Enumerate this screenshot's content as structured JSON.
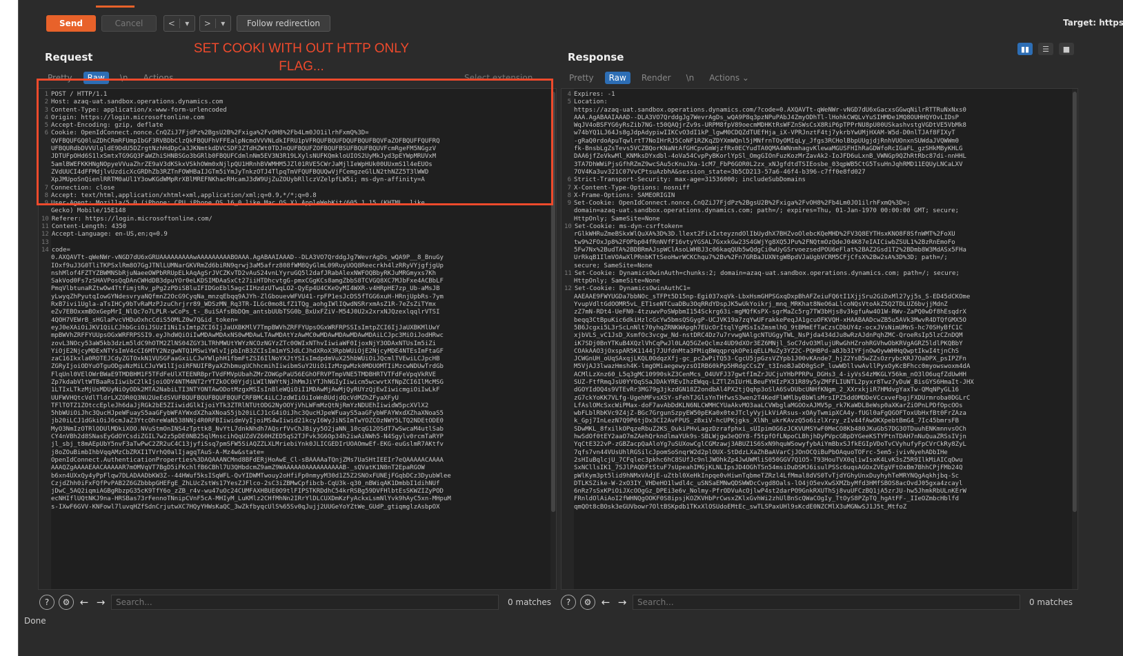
{
  "toolbar": {
    "send": "Send",
    "cancel": "Cancel",
    "back": "<",
    "forward": ">",
    "dropdown_arrow": "▾",
    "follow": "Follow redirection",
    "target": "Target: https"
  },
  "annotation": {
    "line1": "SET COOKI WITH OUT HTTP ONLY",
    "line2": "FLAG..."
  },
  "request": {
    "title": "Request",
    "tabs": [
      "Pretty",
      "Raw",
      "\\n",
      "Actions ⌄"
    ],
    "active_tab": "Raw",
    "select_extension": "Select extension...",
    "lines": [
      {
        "n": "1",
        "t": "POST / HTTP/1.1"
      },
      {
        "n": "2",
        "t": "Host: azaq-uat.sandbox.operations.dynamics.com"
      },
      {
        "n": "3",
        "t": "Content-Type: application/x-www-form-urlencoded"
      },
      {
        "n": "4",
        "t": "Origin: https://login.microsoftonline.com"
      },
      {
        "n": "5",
        "t": "Accept-Encoding: gzip, deflate"
      },
      {
        "n": "6",
        "t": "Cookie: OpenIdConnect.nonce.CnQZiJ7FjdPz%2BgsU2B%2Fxiga%2FvOH8%2Fb4Lm0JO1ilrhFxmQ%3D="
      },
      {
        "n": "",
        "t": "QVFBQUFGQ0luZDhCRmRFUmpIbGF3RVBDbClzQkFBQUFhVFFEalpNcmdVVVNLdkIFRU1pVFRQUFBQUFDQUFBQUFBQVFaZOFBQUFFQUFRQ"
      },
      {
        "n": "",
        "t": "UFBQURdbDVVUlgldE9DdU5DZrgtNzhHdDpCa3JKNmtkdDVCSDF3ZTdHZWt0TDJnQUFBQUFZOFBQUFBSUFBQUFBQUVFcmRgeFM5NGgzV"
      },
      {
        "n": "",
        "t": "JDTUFpOHd6S1lxSmtxTG9GQ3FaWZhiSHNBSGo3bGRlb0FBQUFCdmlnNm5EV3N3R19LXylsNUFKQmkloUIOS2UyMkJyd3pEYWpMRUVxM"
      },
      {
        "n": "",
        "t": "5amlBWEFKKHNgNOpyeVVuaZhrZE9aV3dKSkxVSkhOWm0xNjlpQU1HRnhBVWMHM5JZl01RVE5CWrJaMjlIeWpHUk00UUxmS1l4eEUOs"
      },
      {
        "n": "",
        "t": "ZVdUUCI4dFFMdjlvUzdicXcGRDhZb3RZTnFOWHBaIJGTm5iYmJyTnkzOTJ4TlpqTmVFQUFBQUQwVjFCemgzeGlLN2thNZZ5T3lWWD"
      },
      {
        "n": "",
        "t": "XpJMUpoSnQienlRRTM0aUl1Y3owKGdWMpRrXBlMREFNKhacRHcamJ3dW9UjZuZOUybRllczVZelpfLW5i; ms-dyn-affinity=A"
      },
      {
        "n": "7",
        "t": "Connection: close"
      },
      {
        "n": "8",
        "t": "Accept: text/html,application/xhtml+xml,application/xml;q=0.9,*/*;q=0.8"
      },
      {
        "n": "9",
        "t": "User-Agent: Mozilla/5.0 (iPhone; CPU iPhone OS 16_0 like Mac OS X) AppleWebKit/605.1.15 (KHTML, like"
      },
      {
        "n": "",
        "t": "Gecko) Mobile/15E148"
      },
      {
        "n": "10",
        "t": "Referer: https://login.microsoftonline.com/"
      },
      {
        "n": "11",
        "t": "Content-Length: 4350"
      },
      {
        "n": "12",
        "t": "Accept-Language: en-US,en;q=0.9"
      },
      {
        "n": "13",
        "t": ""
      },
      {
        "n": "14",
        "t": "code="
      },
      {
        "n": "",
        "t": "0.AXQAVTt-qWeNWr-vNGD7dU6xGRUAAAAAAAAAwAAAAAAAAABOAAA.AgABAAIAAAD--DLA3VO7QrddgJg7WevrAgDs_wQA9P__8_BnuGy"
      },
      {
        "n": "",
        "t": "IOxf9uJ3G0TliTKPSxlRm8O7GgJTNlLUMNarGKVRmZd6biRN9qrwj3aM5afrz808fWM8QyGlmL09RuyUOQ8Reecrkh4lzRRyVYjgfjgUp"
      },
      {
        "n": "",
        "t": "nshMlof4FZTYZBWMNSbRjuNaeeOWPbRRUpELkAqAgSrJVCZKvTD2vAuS24vnLYyruGQ5l2dafJRabAlexNWFOQBbyRKJuMRGmyxs7Kh"
      },
      {
        "n": "",
        "t": "SakVod0Fs7zSHAVPosQqDAnCWHdDB3dpuYOr0eLKDSIMDAaSxCt27iiHTDhcvtgG-pmxCGgKCs8amgZbbS8TCVGQ8XC7MJbFxe4ACBbLF"
      },
      {
        "n": "",
        "t": "PmqVlbtunaRZtwOw4TtfimjtRv_pPg2zPDiSBluIFIDGoEbl5agcIIHzdzUTwqLO2-QyEp4U4CKeOyMI4WXR-v4HRpHE7zp_Ub-aMsJB"
      },
      {
        "n": "",
        "t": "yLwyqZhPyutqIowGYNdesvryaNQfmnZ2OcG9CyqNa_mnzqEbqq9AJYh-ZlGbouevWFVU41-rpFP1esJcDS5fTGG6xuH-HRnjUpbRs-7ym"
      },
      {
        "n": "",
        "t": "RxB7ivi1Ugla-aTsIHCy9bTvRaMzPJzuChrjrr89_WDSzMN_Rq3TR-ILGc0mo8LfZ1TQg_aohgIWlIQwdNSRrxmAsZ1R-7eZsZiTYmx"
      },
      {
        "n": "",
        "t": "eZv7EBOxxmBOxGepMrI_NlQc7o7LPLR-wCoPs_t-_8uiSAfsBbDQm_antsbUUbTSG0b_BxUxFZiV-M54J0U2x2xrxNJQzexlqqlrVTSI"
      },
      {
        "n": "",
        "t": "4QOH7VEWrB_sHGlaPvcVHDuOxhcCdiS5OMLZ0w7Q&id_token="
      },
      {
        "n": "",
        "t": "eyJ0eXAiOiJKV1QiLCJhbGciOiJSUzI1NiIsImtpZCI6IjJaUXBKMlV7TmpBWVhZRFFYUpsOGxWRFRPSSIsImtpZCI6IjJaUXBKMlUwY"
      },
      {
        "n": "",
        "t": "mpBWVhZRFFYUUpsOGxWRFRPSSI9.eyJhdWQiOiIwMDAwMDAxNS0wMDAwLTAwMDAtYzAwMC0wMDAwMDAwMDAwMDAiLCJpc3MiOiJodHRwc"
      },
      {
        "n": "",
        "t": "zovL3NOcy53aW5kb3dzLm5ldC9hOTM2ZlNS04ZGY3LTRhMWUtYWYzNCOzNGYzZTc0OWIxNThvIiwiaWF0IjoxNjY3ODAxNTUsIm5iZi"
      },
      {
        "n": "",
        "t": "YiOjE2NjcyMDExNTYsImV4cCI6MTY2NzgwNTQ1MSwiYWlvIjpbInB3ZCIsIm1mYSJdLCJhdXRoX3RpbWUiOjE2NjcyMDE4NTEsImFtaGF"
      },
      {
        "n": "",
        "t": "zaC16Ikxla0ROTEJCdyZGTOxkN1VUSGFaaGxiLCJwYWlphH1fbmFtZSI6IlNoYXJtYSIsImdpdmVuX25hbWUiOiJQcmlTVEwiLCJpcHB"
      },
      {
        "n": "",
        "t": "ZGRyIjoiODYuOTguODguNzMiLCJuYW1lIjoiRFNUIFByaXZhbmugUChhcmihIiwibmSuY2UiOiIzMzgwMzk0MDUOMTIiMzcwNDUwTrdGb"
      },
      {
        "n": "",
        "t": "FlqUnl0VElOWrBWaE9TMDBHM1F5TFdFeUlXTEENRBprTVdFMVpUbahZMrZOWGpPaU56EGhOFRVPTmpVNE5TMDBHRTVTFdFeVpqVkRVE"
      },
      {
        "n": "",
        "t": "Zp7kdabVltWTBaaRsIiwibC2lkIjoiODY4NTM4NT2rYTZkOC00YjdjLWIlNWYtNjJhMmJiYTJhNGIyIiwicm5wcwvtXfNpZCI6IlMcMSG"
      },
      {
        "n": "",
        "t": "1LTIxLTkzMjUsMDUyNiOyODk2MTA2NabiLTI3NTYONTAwODotMzgxMSIsInBleWQiOiI1MDAwMjAwMjQyRUYzQjEwIiwicmgiOiIwLkF"
      },
      {
        "n": "",
        "t": "UUFWVHQtcVdlTldrLXZOR0Q3NU2UeEdSVUFBQUFBQUFBQUFBQUFCRFBMC4iLCJzdWIiOiIoWnBUdjdQcVdMZhZFyaXFyU"
      },
      {
        "n": "",
        "t": "TFlTOTZ1ZOtccEpleJh6daJjRGk2bE5ZIiwidGlkIjoiYTk3ZTRlNTUtODG2NyOOYjVhLWFmMzQtNjRmYzNDUEhIiwidW5pcXVlX2"
      },
      {
        "n": "",
        "t": "5hbWUiOiJhc3QucHJpeWFuayS5aaGFybWFAYWxdXZhaXNoaS5jb20iLCJ1cG4iOiJhc3QucHJpeWFuayS5aaGFybWFAYWxdXZhaXNoaS5"
      },
      {
        "n": "",
        "t": "jb20iLCJ1dGkiOiJ6cmJaZ3YtcOhreWaN538NNj4R0RFBIiwidmVyIjoiMS4wIiwid21kcyI6WyJiNSImTwYOZCOzNWY5LTQ2NDEtODE0"
      },
      {
        "n": "",
        "t": "MyO3NmIzOTRlODUlMDkiXOO.NVuStmOnINS4zTpttk8_NvYtL7dnkNhdh7AQsrfVvChJBiyy5O2jaNN_10cqG12OSdT7wSwcaM4utlSab"
      },
      {
        "n": "",
        "t": "CY4nVBh2d8SNasEyGdOYCsdiZGIL7w2z5pDE0NB25qlMnscihQqUZdVZ60HZED5qS2TJFvk3G6Op34h2iwAiNWh5-N4Sgylv0rcmTaRYP"
      },
      {
        "n": "",
        "t": "jl_sbj_t8mAEpUbY5nvF3aTwPwC2ZR2uC4C13jyfiSsq7pmSFW5SiAQZZLXLMriebiYnk0JLICGEDIrUOAOmwEf-EKG-euGslmR7AKtfv"
      },
      {
        "n": "",
        "t": "j8oZOuBimbIhbVqqAMzCbZRXI1TVrhQ0alIjagqTAuS-A-Mz4w&state="
      },
      {
        "n": "",
        "t": "OpenIdConnect.AuthenticationProperties%3DAQAAANCMnd8BFdERjHoAwE_Cl-sBAAAAaTQnjZMs7UaSHtIEEIr7eQAAAAACAAAA"
      },
      {
        "n": "",
        "t": "AAAQZgAAAAEAACAAAAAR7mOMVqVT7BgD5iFKchlfB6CBhl7U3QHbdcmZ9amZ9WAAAAA0AAAAAAAAAAB-_sQVatK1N8nT2EpaRGOW"
      },
      {
        "n": "",
        "t": "b6xn4UXxQy4yPpFlqw7DLADAADbKW3Z--44HWuf5ksISqWFL-QvYIDWMTwouy2oHfiFp0nmyyM30d1Z5Z2SNOxFUNEjFGqbDCz3DyubWlee"
      },
      {
        "n": "",
        "t": "CzjdZhh0iFxFQfPvPAB2Z6GZbbbpGHEFgE_ZhLUcZstWs17YesZJFlco-2sC3iZBMwCpfibcb-CqU3k-q30_nBWiqAK1DmbbI1dihNUf"
      },
      {
        "n": "",
        "t": "jDwC_5AQ2iqmiAGBgRbzpG35cK9TfY6o_zZB_r4v-wu47uOc24CUMFAXHBUE0O9tlFIPSTKRDdhC54krRSBg59DVFHlbtEsSKWZIZyPOD"
      },
      {
        "n": "",
        "t": "ecNHIflUQtNKJ9na-HRSBas73rFennoTNnipCVnF5cA-MHIyM_LuKMlz2CHfMhNn2IRrYlDLCUXDmKzFyAckxLsmNlYvk9hAyC5xn-MHpuM"
      },
      {
        "n": "",
        "t": "s-IXwF6GVV-KNFowl7luvqHZfSdnCrjutwXC7HQyYHWsKaQC_3wZkfbyqcUlS%65Sv0qJujj2UUGeYoYZtWe_GUdP_gtiqmglzAsbpOX"
      }
    ]
  },
  "response": {
    "title": "Response",
    "tabs": [
      "Pretty",
      "Raw",
      "Render",
      "\\n",
      "Actions ⌄"
    ],
    "active_tab": "Raw",
    "lines": [
      {
        "n": "4",
        "t": "Expires: -1"
      },
      {
        "n": "5",
        "t": "Location:"
      },
      {
        "n": "",
        "t": "https://azaq-uat.sandbox.operations.dynamics.com/?code=0.AXQAVTt-qWeNWr-vNGD7dU6xGacxsGGwqNilrRTTRuNxNxs0"
      },
      {
        "n": "",
        "t": "AAA.AgABAAIAAAD--DLA3VO7QrddgJg7WevrAgDs_wQA9P8q3pzNPuPAbJ4ZmyODhTl-lHohkCWQLvYuSIHMDe1MQ8OUHHQYOvLIDsP"
      },
      {
        "n": "",
        "t": "WqJV4oBSFYG6yRsZib7NG-t50QAQjrZv9s-URPM8fpV89oecmMDHKtRsWFZnSWsCsX8RiP6pTPPrNU8pU00USkashvstgVGDtVE5VbMk8"
      },
      {
        "n": "",
        "t": "w74bYQ1LJ64Js8gJdpAdypiwIIKCvO3dI1kP_lgwM0CDQZdTUEfHja_iX-VPRJnztF4tj7ykrbYwUMjHXAM-W5d-D0nlTJAf8FIXyT"
      },
      {
        "n": "",
        "t": "-gRaQ0rdoApuTqwlrtT7NoIHrRJ5CoNF1RZKqZDYXmWQnl5jMNfrnTOyOMIqLy_Jfgs3RCHolBbpUUgjdjRnhVUOnxnSUWdaJVQWWm0"
      },
      {
        "n": "",
        "t": "fk-BnsbLgZsTevs5VCZBQorKNaNtAfGHCpvGmWjzfRx0ECYudTA0QMA4WNnmhagvKlewaMGUSFHIhRaGDWfoRcIGaFL_gzSHkMByKHLG"
      },
      {
        "n": "",
        "t": "DAA6jfZeVkwMl_KNMksDYxdbl-4oVa54CvpPyBKorlYpSl_OmgGIOnFuzKozMrZavAk2-IoJFD6uLxnB_VWNGp9QZhRtRbc87di-nnHHL"
      },
      {
        "n": "",
        "t": "3TA7DhWWiPjsGfhRZmZ9wcSAu5cKnuJXa-1cM7_FbP6GOR0L2zx_xNJgfdtdTSIEosbe_03qpWB5CtG5TsuHnJqhRMD11EQUyLNCaLXV"
      },
      {
        "n": "",
        "t": "7OV4Ka3uv321C07VvCPtsuAzbhA&session_state=3b5CD213-57a6-46f4-b396-c7ff0e8fd027"
      },
      {
        "n": "6",
        "t": "Strict-Transport-Security: max-age=31536000; includeSubDomains"
      },
      {
        "n": "7",
        "t": "X-Content-Type-Options: nosniff"
      },
      {
        "n": "8",
        "t": "X-Frame-Options: SAMEORIGIN"
      },
      {
        "n": "9",
        "t": "Set-Cookie: OpenIdConnect.nonce.CnQZiJ7FjdPz%2BgsU2B%2Fxiga%2FvOH8%2Fb4Lm0JO1ilrhFxmQ%3D=;"
      },
      {
        "n": "",
        "t": "domain=azaq-uat.sandbox.operations.dynamics.com; path=/; expires=Thu, 01-Jan-1970 00:00:00 GMT; secure;"
      },
      {
        "n": "",
        "t": "HttpOnly; SameSite=None"
      },
      {
        "n": "10",
        "t": "Set-Cookie: ms-dyn-csrftoken="
      },
      {
        "n": "",
        "t": "rGlkWHRuZmeBSkxWlQuXA%3D%3D.llext2FixIxteyzndOlIbUydhX7BHZvoOlebcKQeMHD%2FV3Q8EYTHsxKNO8F8SfnWMT%2FoXU"
      },
      {
        "n": "",
        "t": "tw9%2FOxJp8%2FOPbp04fRnNVfF16vtyYGSAL7GxxkGw23S4GWjYg8XQ5JPu%2FNQtmOzQdeJ04K87eIAICiwbZSUL1%2BzRnEmoFo"
      },
      {
        "n": "",
        "t": "5Fw7Nx%2BudTA%2BDBRmAJspWClAsoLWHBJ3c06kaqQUb5wQdgCi0wUyGSrvoezsedPOU6eFlat%2BAZ2Gsd1T2%2BDmb8W3MdASx5FHa"
      },
      {
        "n": "",
        "t": "UrRkqB1IlmVOAwXlPRnbKTtSeoHwrWCKChqu7%2Bv%2Fn7GRBaJUXNtgWBpdVJaUgbVCRM5CFjCfsX%2Bw2sA%3D%3D; path=/;"
      },
      {
        "n": "",
        "t": "secure; SameSite=None"
      },
      {
        "n": "11",
        "t": "Set-Cookie: DynamicsOwinAuth=chunks:2; domain=azaq-uat.sandbox.operations.dynamics.com; path=/; secure;"
      },
      {
        "n": "",
        "t": "HttpOnly; SameSite=None"
      },
      {
        "n": "12",
        "t": "Set-Cookie: DynamicsOwinAuthC1="
      },
      {
        "n": "",
        "t": "AAEAAE9FWYUGDa7bbNOc_sTFPt5D15np-Egi037xqVk-LbxHsmGHPSGxqDxpBhAFZeiuFQ6tI1XjjSru2GiDxMl27yj5s_S-ED45dCKOme"
      },
      {
        "n": "",
        "t": "YvupVdltGdOOMR5vL_ET1seNTCuaDBu3OqRRdYDspJK5wUkYoikrj_mnq_MRKhat8NeO6aLlcoNQsVtoAkZ5Q2TDLUZ6bvjjMdnZ"
      },
      {
        "n": "",
        "t": "zZ7mN-RDt4-UeFN0-4tzuwvPoSWpbmI154Sckrg63i-mgMQfKsPX-sgrMaZc5rg7TW3bHjs8v3kgfuAw4O1W-RWv-ZaPQ0wDf8hEsqdrX"
      },
      {
        "n": "",
        "t": "beqq3CtBpuKic6dkiHzlcGcYw5bmsQSGygP-UCJVK19a7zqYwUFrakkePeqJA1gcuOFKVQH-xHAABAADcwZB5u5AVk3MwvR4DTQfGMX5O"
      },
      {
        "n": "",
        "t": "5B6Jcgxi5L3rScLnNlt70yhqZRNKWApgh7EUcOrItqlYgMSsIsZmsmlhQ_9tBMmEfTaCzsCDbUY4z-ocxJVsNimUMnS-hc70SHyBfC1C"
      },
      {
        "n": "",
        "t": "xjbVLS_vC1JsD_XsmfOc3vcgw_Nd-nstDRC4Dz7u7rvwgNAlgcNTUGgyTWL_NsPjda434dJu8wRzAJdnPqhZMC-QroeRsIp5lzCZnDQM"
      },
      {
        "n": "",
        "t": "iK7SDj0BnYTKuB4XQzlVhCqPwJl0LAQ5GZeQclmz4UD9dXOr3EZ6MNjl_SoC7dvO3MlujURwGhHZrohRGVhwObKRVgAGRZ5ldlPKQBbY"
      },
      {
        "n": "",
        "t": "COAkAAO3jOxspAR5K1144j7JUfdnMta3FMiqBWqqprqkOPeiqELLMuZy3YZ2C-PQHBPd-a8Jb3IYFjnOwOywWHHqQwptIkwI4tjnChS"
      },
      {
        "n": "",
        "t": "JCWGnUH_oUqSAxqjLKQL0OdqzXfj-gc_pcZwPiTQ53-CgcU5jpGzsVZYpb1J00vKAnde7_hjZ2YsB5wZZsOzrybcKRJ7OaDPX_psIPZFn"
      },
      {
        "n": "",
        "t": "M5VjAJ3lwazHmsh4K-lmgOMiaegewyzsOIRB60kPp5HRdgCCsZY_t3InoBJaDD0gScP_luwWDllvwAvllPyxOyKcBFhcc0myowswoxm4dA"
      },
      {
        "n": "",
        "t": "ACMlLzXnz60_L5q3gMC10990skZ3CenMcs_O4UVFJ37gwtfImZrJUCjuYHbPPRPu_DGHs3_4-iyVsS4zMKGLY56km_nO3lO6uqfZdUwHH"
      },
      {
        "n": "",
        "t": "SUZ-FtfRmqJsU0YYOqSSaJDAkYREvIhzEWqq-LZTlZnIUrHLBeuFYHIzPX31R89y5yZMFFLIUNTL2pyxr8Twz7yDuW_BisGYS6HmaIt-JHX"
      },
      {
        "n": "",
        "t": "dGOYIdOQ4s9VTEvRr3MG79g3jkzdGN18Z2ondbAl4PX2tjQqhp3oSlA6SvDUbcUNHfKNgm_2_XXrxkjiR7HMdvgYaxTw-QMqNPyGL16"
      },
      {
        "n": "",
        "t": "zG7ckYoKK7VLfg-UgehMFvsXSY-sFehTJGlsYnTHfwsS3wen2T4KedFlWMlbyBbWlsMrsIPZ5ddOMDDeVCcxveFbgjFXDUrmroba0DGLrC"
      },
      {
        "n": "",
        "t": "LfAslOMcSxcWiPMax-doF7avAbDdKLN6NLCWMHCYUaAkvMO3aaLCVWbglaMGOOxAJMV5p_rk7KaWDLBeWsp0aXKarZiOPnLPDfOpcOOs"
      },
      {
        "n": "",
        "t": "wbFLblRbKVc9Z4jZ-BGc7GrgunSzpyEW50pEKa0x0teJTclyVyjLkViARsus-xOAyTwmipXCA4y-fUGl0aFgQGOFToxUbHxfBt0FrZAza"
      },
      {
        "n": "",
        "t": "k_Gpj7InLezN7Q9P6tjDx3CI2AvFPUS_zBxiV-hcUPKjgks_XlNh_ukrKAvzQ5o6izlXrzy_zIv44fAwOKXpebtBmG4_7Ic45bmrsFB"
      },
      {
        "n": "",
        "t": "SDwMKL_8fxilkOPqzeRbuZ2KS_OukiPHvLagzDzrafphxi_sUIpimOG6zJCKVUMSYwF0MeCO8Kb480JKuGbS7DG3OTDuuhENKmnnvsOCh"
      },
      {
        "n": "",
        "t": "hwSdOf0tEY2aaO7mZAehQrkndlmaYUk9s-SBLWjgw3eQOY8-f5tpfOfLNpoCLBhjhDyPVpcGBpDYGeeKSTYPtnTDAH7nNuQuaZRSsIVjn"
      },
      {
        "n": "",
        "t": "YqCtE322vP-zGBZacpQaAloYg7uSUXowCglCGMzawj3ABUZ1S6SxN9hquWSowyfybAiYmBbxSJfkEGIpVDoTvCVyhufyFpCVrCkRy8ZyL"
      },
      {
        "n": "",
        "t": "7qfs7vn44VUsUhlRGSilcJpomSoSnqrW2d2plOUX-StDdzLXaZhBaAVarCjJOnOCQiBuPbOAquoTOFrc-5em5-jvivNyehADbIHe"
      },
      {
        "n": "",
        "t": "2sHIuBqlcjU_7CFqlec3pkhc6hC8SUfJc9nlJWOhkZp4JwUWMliS050GGV7Q1O5-T93HouTVX0qliwIsxK4LvK3sZ5R9IlkMiAICqOwu"
      },
      {
        "n": "",
        "t": "SxNCllsIK1_7SJlPAQDFtStuF7sUpeahIMGjKLNLIpsJD4OGhTSn54msiDuDSMJ6isulPSSc6uqsAGOxZVEgVFtOxBm7BhhCPjFMb24Q"
      },
      {
        "n": "",
        "t": "pWlKym3pt5lid9hNMxVAdjE-uZtbl0XeHkInpqe0vHiwnTqbmeTZRzl4LfMmal8dVS0TvTjdYGhyUnxDuyhyhTeMRYNQgAqkhjbq-Sc"
      },
      {
        "n": "",
        "t": "DTLKSZike-W-2xO3IY_VHDeHO1lwdl4c_uSNSaEMNwQDSWWDcCvgd8Oals-lO4jO5evXwSXMZbyMfd3HMfSBOS8acOvdJ05gxa4zcayl"
      },
      {
        "n": "",
        "t": "6nRz7sSxKPiOiJXcOOgGz_DPEi3e6v_Nolmy-PfrODVuAcOjlwP4st2darPO9GnkRXUThSj8vuUFCzBQ1jA5zrJU-hw5JhmkRbULnKErW"
      },
      {
        "n": "",
        "t": "FRnldOlAiAoI2fWHNQgOOKF0S8ipsjKOZKVHbPrCwsxZKlxGvhWi2zhUlBnScQWaCOgIy_TtOyS8PZpTQ_hgAtFF-_IIeOZmbcHblfd"
      },
      {
        "n": "",
        "t": "qmQOt8cBOsk3eGUVbowr7OltBSKpdb1TKxXlOSUdoEMtEc_swTLSPaxUHl9sKcdE0NZCMlX3uMGNwSJ1J5t_MtfoZ"
      }
    ]
  },
  "search": {
    "placeholder": "Search...",
    "matches": "0 matches"
  },
  "status": {
    "text": "Done"
  },
  "icons": {
    "help": "?",
    "gear": "⚙",
    "prev": "←",
    "next": "→"
  },
  "colors": {
    "send": "#e8622a",
    "active_tab": "#2d6eb5",
    "annotation": "#ef4a2c",
    "bg": "#2b2b2b"
  }
}
